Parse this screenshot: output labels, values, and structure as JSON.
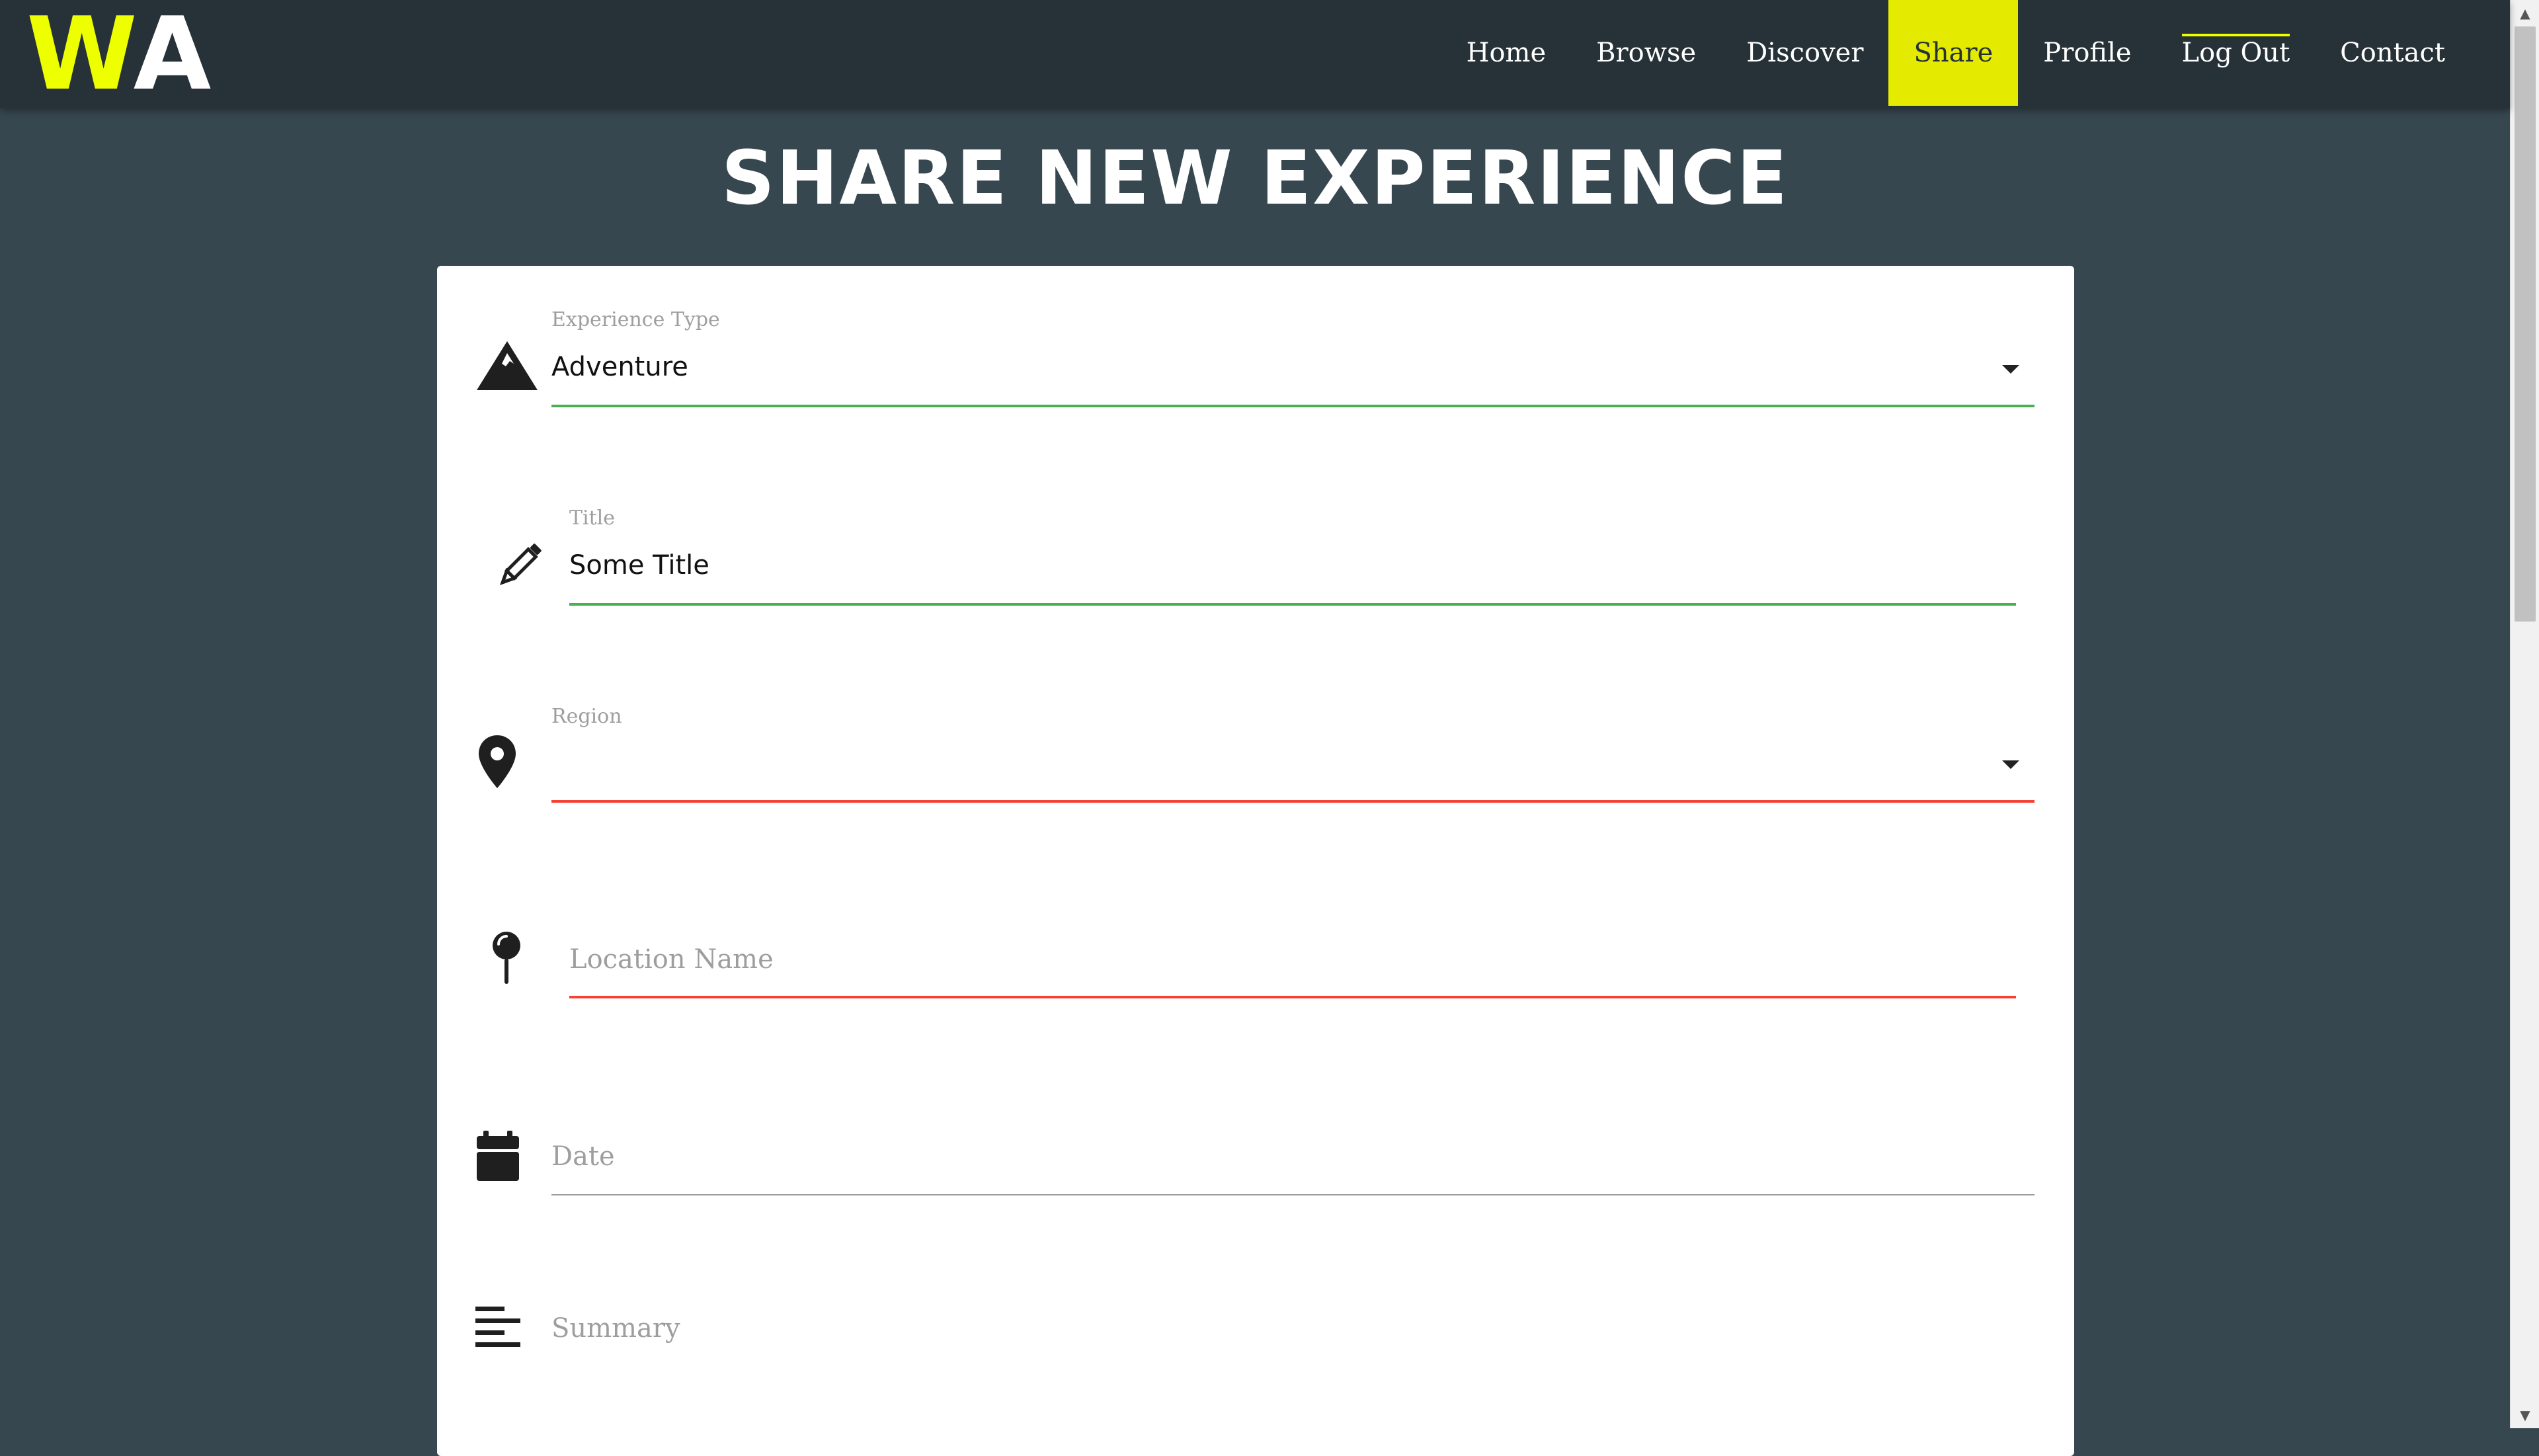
{
  "header": {
    "logo_part1": "W",
    "logo_part2": "A",
    "nav": [
      {
        "label": "Home"
      },
      {
        "label": "Browse"
      },
      {
        "label": "Discover"
      },
      {
        "label": "Share",
        "active": true
      },
      {
        "label": "Profile"
      },
      {
        "label": "Log Out"
      },
      {
        "label": "Contact"
      }
    ]
  },
  "page": {
    "title": "SHARE NEW EXPERIENCE"
  },
  "form": {
    "experience_type": {
      "label": "Experience Type",
      "value": "Adventure",
      "icon": "mountain-icon",
      "state": "valid"
    },
    "title": {
      "label": "Title",
      "value": "Some Title",
      "icon": "pencil-icon",
      "state": "valid"
    },
    "region": {
      "label": "Region",
      "value": "",
      "icon": "map-marker-icon",
      "state": "invalid"
    },
    "location_name": {
      "placeholder": "Location Name",
      "icon": "pushpin-icon",
      "state": "invalid"
    },
    "date": {
      "placeholder": "Date",
      "icon": "calendar-icon",
      "state": "default"
    },
    "summary": {
      "placeholder": "Summary",
      "icon": "text-align-left-icon",
      "state": "default"
    }
  },
  "colors": {
    "navbar_bg": "#263238",
    "page_bg": "#37474f",
    "accent_yellow": "#e4ea00",
    "valid_green": "#4caf50",
    "invalid_red": "#f44336"
  }
}
